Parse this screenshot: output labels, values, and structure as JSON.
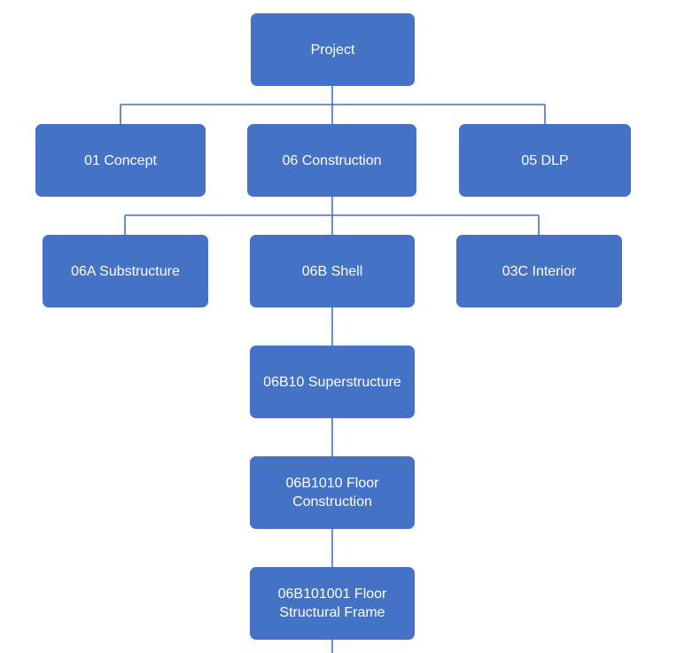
{
  "colors": {
    "node_fill": "#4472C4",
    "node_text": "#FFFFFF",
    "connector": "#4472C4"
  },
  "nodes": {
    "project": "Project",
    "concept": "01 Concept",
    "construction": "06 Construction",
    "dlp": "05 DLP",
    "substructure": "06A Substructure",
    "shell": "06B Shell",
    "interior": "03C Interior",
    "superstructure": "06B10 Superstructure",
    "floor_construction": "06B1010 Floor Construction",
    "floor_structural_frame": "06B101001 Floor Structural Frame"
  }
}
